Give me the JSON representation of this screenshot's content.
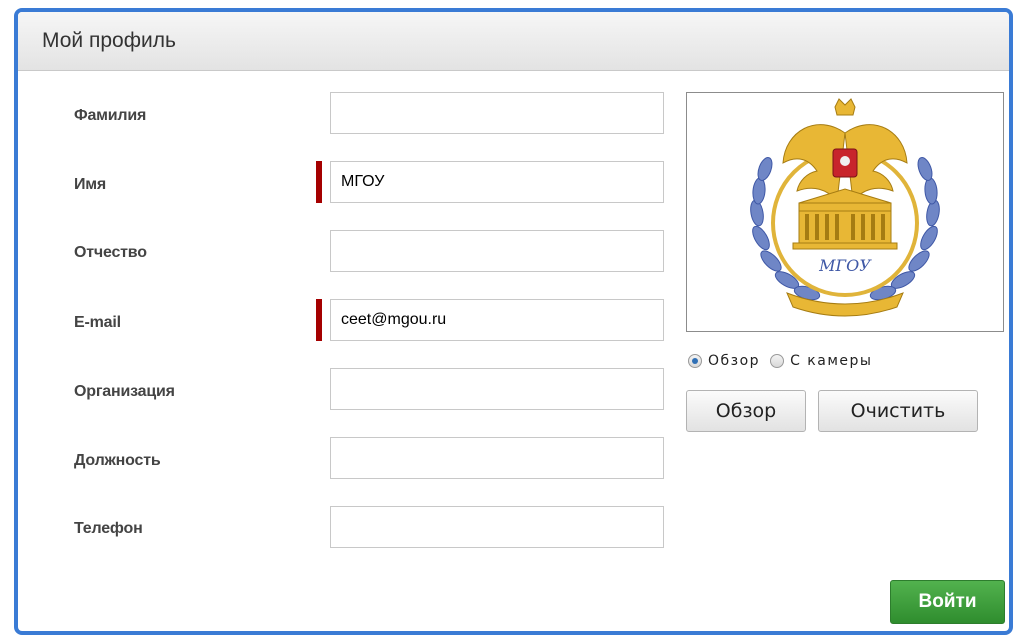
{
  "dialog": {
    "title": "Мой профиль"
  },
  "form": {
    "fields": [
      {
        "label": "Фамилия",
        "value": "",
        "required": false
      },
      {
        "label": "Имя",
        "value": "МГОУ",
        "required": true
      },
      {
        "label": "Отчество",
        "value": "",
        "required": false
      },
      {
        "label": "E-mail",
        "value": "ceet@mgou.ru",
        "required": true
      },
      {
        "label": "Организация",
        "value": "",
        "required": false
      },
      {
        "label": "Должность",
        "value": "",
        "required": false
      },
      {
        "label": "Телефон",
        "value": "",
        "required": false
      }
    ]
  },
  "photo": {
    "logo_text": "МГОУ",
    "source_options": [
      {
        "label": "Обзор",
        "checked": true
      },
      {
        "label": "С камеры",
        "checked": false
      }
    ],
    "browse_label": "Обзор",
    "clear_label": "Очистить"
  },
  "actions": {
    "login_label": "Войти"
  },
  "colors": {
    "frame": "#3a7bd5",
    "required_marker": "#a50000",
    "login_button": "#3a9a38"
  }
}
